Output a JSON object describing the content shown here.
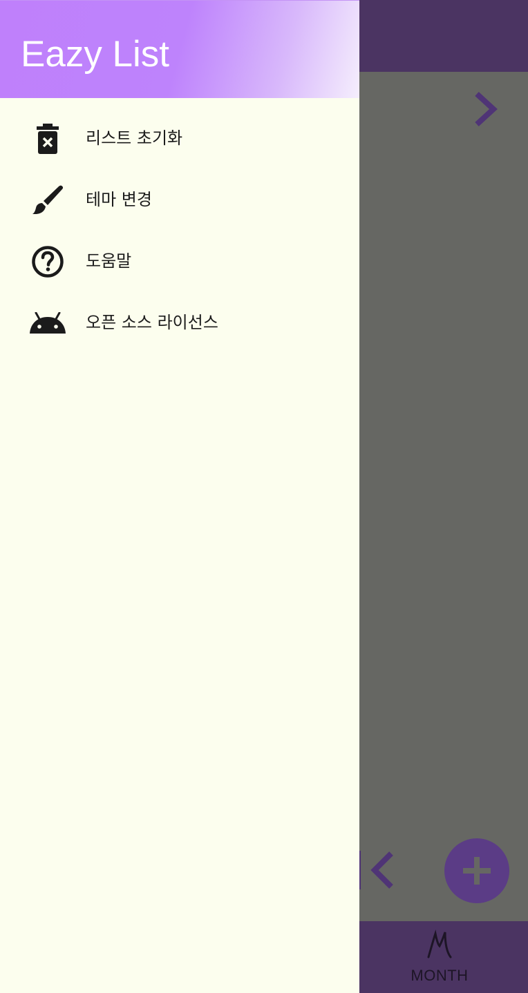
{
  "app": {
    "bottom_nav": {
      "month_label": "MONTH"
    }
  },
  "drawer": {
    "title": "Eazy List",
    "items": [
      {
        "label": "리스트 초기화",
        "icon": "delete-forever-icon"
      },
      {
        "label": "테마 변경",
        "icon": "brush-icon"
      },
      {
        "label": "도움말",
        "icon": "help-circle-icon"
      },
      {
        "label": "오픈 소스 라이선스",
        "icon": "android-icon"
      }
    ]
  },
  "colors": {
    "accent": "#bf80fb",
    "app_bar": "#4b3462",
    "scrim": "#666763",
    "drawer_bg": "#fcfeee"
  }
}
